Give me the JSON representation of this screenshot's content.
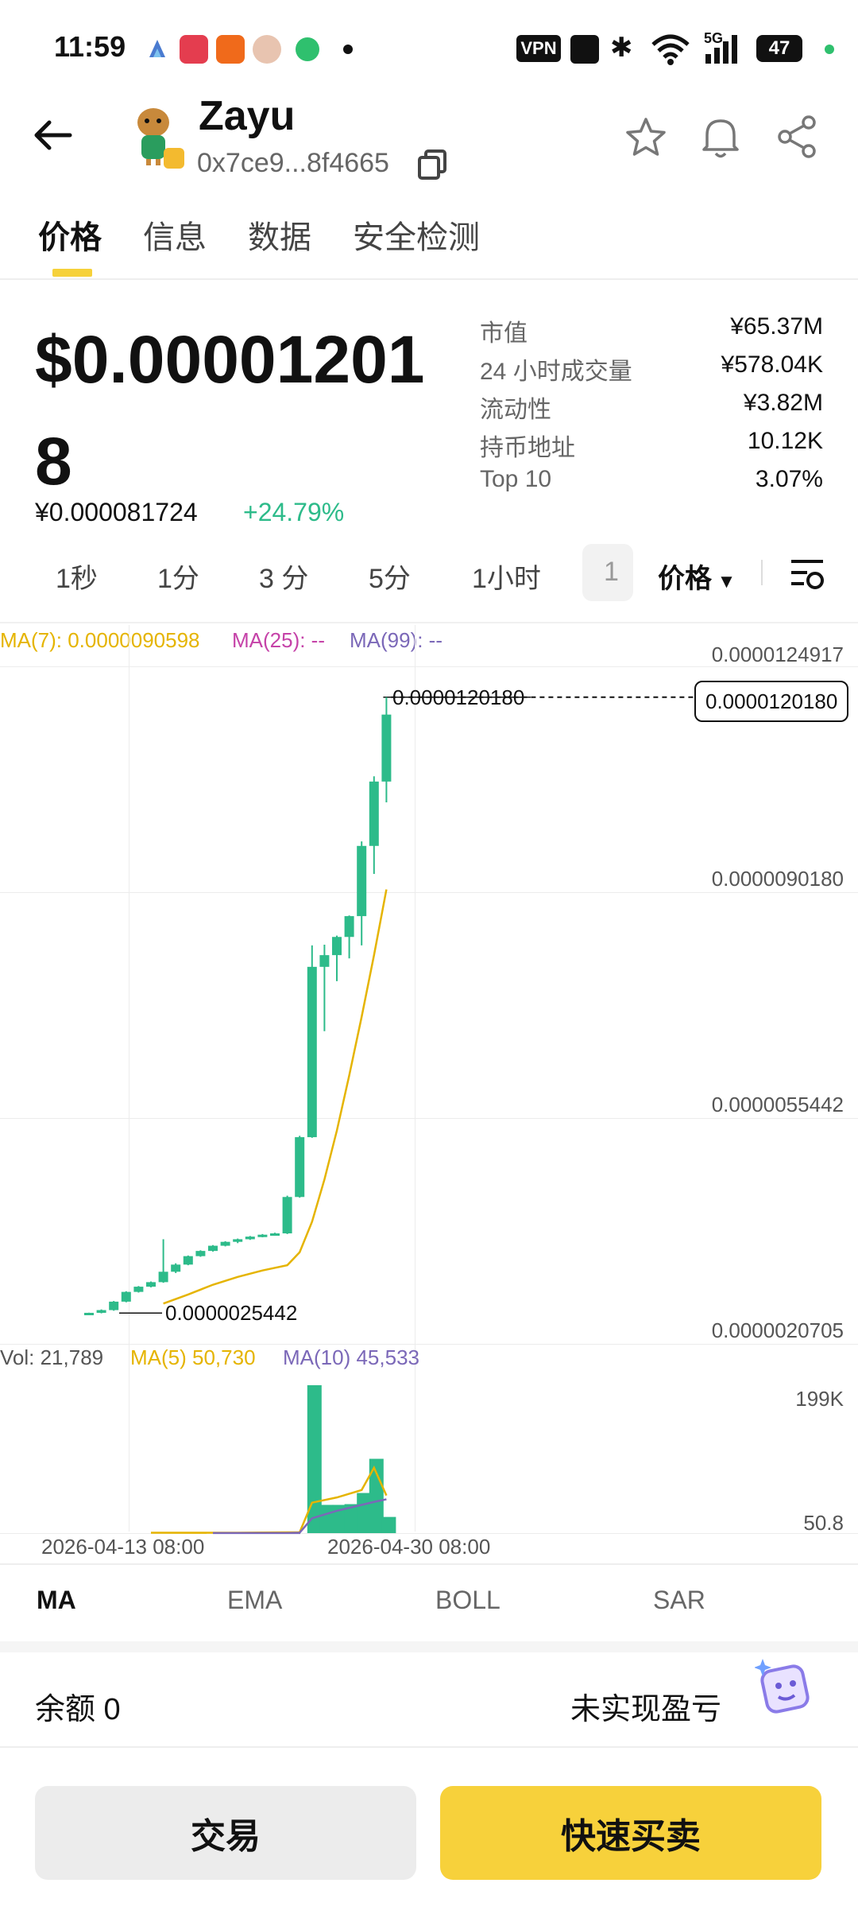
{
  "status_bar": {
    "time": "11:59",
    "vpn": "VPN",
    "signal": "5G",
    "battery": "47"
  },
  "header": {
    "token_name": "Zayu",
    "address": "0x7ce9...8f4665",
    "back_icon": "arrow-left-icon",
    "actions": [
      "star-icon",
      "bell-icon",
      "share-icon"
    ]
  },
  "tabs": [
    {
      "label": "价格",
      "active": true
    },
    {
      "label": "信息",
      "active": false
    },
    {
      "label": "数据",
      "active": false
    },
    {
      "label": "安全检测",
      "active": false
    }
  ],
  "price": {
    "usd": "$0.000012018",
    "cny": "¥0.000081724",
    "change": "+24.79%",
    "change_color": "#2DBB8A"
  },
  "stats": [
    {
      "label": "市值",
      "value": "¥65.37M"
    },
    {
      "label": "24 小时成交量",
      "value": "¥578.04K"
    },
    {
      "label": "流动性",
      "value": "¥3.82M"
    },
    {
      "label": "持币地址",
      "value": "10.12K"
    },
    {
      "label": "Top 10",
      "value": "3.07%"
    }
  ],
  "timeframes": {
    "items": [
      "1秒",
      "1分",
      "3 分",
      "5分",
      "1小时",
      "1"
    ],
    "price_dropdown": "价格"
  },
  "chart_legend": {
    "ma7": "MA(7): 0.0000090598",
    "ma25": "MA(25): --",
    "ma99": "MA(99): --",
    "vol": "Vol: 21,789",
    "vma5": "MA(5) 50,730",
    "vma10": "MA(10) 45,533"
  },
  "axis": {
    "price_ticks": [
      "0.0000124917",
      "0.0000090180",
      "0.0000055442",
      "0.0000020705"
    ],
    "current_price_tag": "0.0000120180",
    "high_label": "0.0000120180",
    "low_label": "0.0000025442",
    "vol_ticks": [
      "199K",
      "50.8"
    ],
    "dates": [
      "2026-04-13 08:00",
      "2026-04-30 08:00"
    ]
  },
  "indicators": [
    {
      "label": "MA",
      "active": true
    },
    {
      "label": "EMA",
      "active": false
    },
    {
      "label": "BOLL",
      "active": false
    },
    {
      "label": "SAR",
      "active": false
    }
  ],
  "bottom": {
    "balance_label": "余额 0",
    "unrealized_pnl": "未实现盈亏",
    "trade_button": "交易",
    "quick_button": "快速买卖"
  },
  "colors": {
    "accent": "#F7D13B",
    "up": "#2DBB8A",
    "ma7": "#E5B400",
    "ma25": "#C542A8",
    "ma99": "#7B68B8"
  },
  "chart_data": {
    "type": "candlestick",
    "y_range": [
      2.0705e-06,
      1.24917e-05
    ],
    "candles": [
      {
        "o": 2.5442e-06,
        "h": 2.55e-06,
        "l": 2.53e-06,
        "c": 2.548e-06
      },
      {
        "o": 2.548e-06,
        "h": 2.6e-06,
        "l": 2.54e-06,
        "c": 2.59e-06
      },
      {
        "o": 2.59e-06,
        "h": 2.73e-06,
        "l": 2.58e-06,
        "c": 2.72e-06
      },
      {
        "o": 2.72e-06,
        "h": 2.88e-06,
        "l": 2.71e-06,
        "c": 2.87e-06
      },
      {
        "o": 2.87e-06,
        "h": 2.96e-06,
        "l": 2.86e-06,
        "c": 2.95e-06
      },
      {
        "o": 2.95e-06,
        "h": 3.03e-06,
        "l": 2.94e-06,
        "c": 3.02e-06
      },
      {
        "o": 3.02e-06,
        "h": 3.68e-06,
        "l": 3.01e-06,
        "c": 3.18e-06
      },
      {
        "o": 3.18e-06,
        "h": 3.31e-06,
        "l": 3.16e-06,
        "c": 3.29e-06
      },
      {
        "o": 3.29e-06,
        "h": 3.43e-06,
        "l": 3.28e-06,
        "c": 3.42e-06
      },
      {
        "o": 3.42e-06,
        "h": 3.51e-06,
        "l": 3.41e-06,
        "c": 3.5e-06
      },
      {
        "o": 3.5e-06,
        "h": 3.59e-06,
        "l": 3.49e-06,
        "c": 3.58e-06
      },
      {
        "o": 3.58e-06,
        "h": 3.65e-06,
        "l": 3.57e-06,
        "c": 3.64e-06
      },
      {
        "o": 3.64e-06,
        "h": 3.69e-06,
        "l": 3.62e-06,
        "c": 3.68e-06
      },
      {
        "o": 3.68e-06,
        "h": 3.73e-06,
        "l": 3.67e-06,
        "c": 3.72e-06
      },
      {
        "o": 3.72e-06,
        "h": 3.76e-06,
        "l": 3.71e-06,
        "c": 3.75e-06
      },
      {
        "o": 3.75e-06,
        "h": 3.78e-06,
        "l": 3.74e-06,
        "c": 3.77e-06
      },
      {
        "o": 3.77e-06,
        "h": 4.35e-06,
        "l": 3.76e-06,
        "c": 4.33e-06
      },
      {
        "o": 4.33e-06,
        "h": 5.27e-06,
        "l": 4.32e-06,
        "c": 5.25e-06
      },
      {
        "o": 5.25e-06,
        "h": 8.2e-06,
        "l": 5.24e-06,
        "c": 7.87e-06
      },
      {
        "o": 7.87e-06,
        "h": 8.21e-06,
        "l": 6.88e-06,
        "c": 8.05e-06
      },
      {
        "o": 8.05e-06,
        "h": 8.35e-06,
        "l": 7.65e-06,
        "c": 8.33e-06
      },
      {
        "o": 8.33e-06,
        "h": 8.66e-06,
        "l": 8e-06,
        "c": 8.65e-06
      },
      {
        "o": 8.65e-06,
        "h": 9.8e-06,
        "l": 8.2e-06,
        "c": 9.73e-06
      },
      {
        "o": 9.73e-06,
        "h": 1.08e-05,
        "l": 9.3e-06,
        "c": 1.072e-05
      },
      {
        "o": 1.072e-05,
        "h": 1.2018e-05,
        "l": 1.04e-05,
        "c": 1.175e-05
      }
    ],
    "ma7": [
      {
        "i": 6,
        "v": 2.69e-06
      },
      {
        "i": 8,
        "v": 2.83e-06
      },
      {
        "i": 10,
        "v": 2.98e-06
      },
      {
        "i": 12,
        "v": 3.1e-06
      },
      {
        "i": 14,
        "v": 3.2e-06
      },
      {
        "i": 16,
        "v": 3.28e-06
      },
      {
        "i": 17,
        "v": 3.48e-06
      },
      {
        "i": 18,
        "v": 3.95e-06
      },
      {
        "i": 19,
        "v": 4.6e-06
      },
      {
        "i": 20,
        "v": 5.35e-06
      },
      {
        "i": 21,
        "v": 6.2e-06
      },
      {
        "i": 22,
        "v": 7.1e-06
      },
      {
        "i": 23,
        "v": 8.05e-06
      },
      {
        "i": 24,
        "v": 9.0598e-06
      }
    ],
    "volume": {
      "range": [
        0,
        199000
      ],
      "bars": [
        {
          "i": 18,
          "v": 199000
        },
        {
          "i": 19,
          "v": 38000
        },
        {
          "i": 20,
          "v": 38000
        },
        {
          "i": 21,
          "v": 39000
        },
        {
          "i": 22,
          "v": 54000
        },
        {
          "i": 23,
          "v": 100000
        },
        {
          "i": 24,
          "v": 21789
        }
      ],
      "ma5": [
        {
          "i": 0,
          "v": 400
        },
        {
          "i": 5,
          "v": 500
        },
        {
          "i": 12,
          "v": 500
        },
        {
          "i": 17,
          "v": 1200
        },
        {
          "i": 18,
          "v": 41000
        },
        {
          "i": 20,
          "v": 48000
        },
        {
          "i": 22,
          "v": 58000
        },
        {
          "i": 23,
          "v": 88000
        },
        {
          "i": 24,
          "v": 50730
        }
      ],
      "ma10": [
        {
          "i": 5,
          "v": 200
        },
        {
          "i": 10,
          "v": 200
        },
        {
          "i": 16,
          "v": 200
        },
        {
          "i": 17,
          "v": 600
        },
        {
          "i": 18,
          "v": 20000
        },
        {
          "i": 20,
          "v": 30000
        },
        {
          "i": 22,
          "v": 38000
        },
        {
          "i": 23,
          "v": 42000
        },
        {
          "i": 24,
          "v": 45533
        }
      ]
    }
  }
}
